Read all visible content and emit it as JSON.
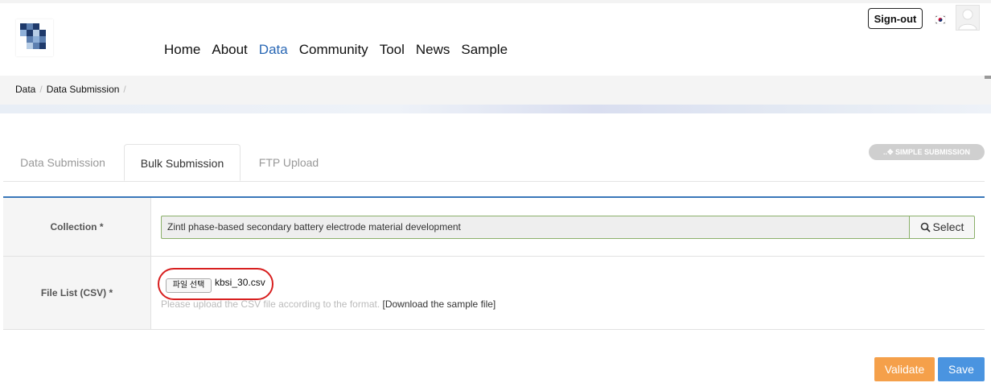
{
  "nav": {
    "items": [
      {
        "label": "Home"
      },
      {
        "label": "About"
      },
      {
        "label": "Data",
        "active": true
      },
      {
        "label": "Community"
      },
      {
        "label": "Tool"
      },
      {
        "label": "News"
      },
      {
        "label": "Sample"
      }
    ],
    "active_color": "#2a68b5"
  },
  "account": {
    "signout_label": "Sign-out",
    "language_icon": "korea-flag-icon",
    "avatar_icon": "user-avatar-icon"
  },
  "breadcrumb": {
    "items": [
      "Data",
      "Data Submission"
    ]
  },
  "tabs": {
    "items": [
      {
        "label": "Data Submission"
      },
      {
        "label": "Bulk Submission",
        "active": true
      },
      {
        "label": "FTP Upload"
      }
    ]
  },
  "simple_submission": {
    "label": "SIMPLE SUBMISSION",
    "icon": "move-icon"
  },
  "form": {
    "collection_label": "Collection *",
    "collection_value": "Zintl phase-based secondary battery electrode material development",
    "select_label": "Select",
    "select_icon": "search-icon",
    "file_label": "File List (CSV) *",
    "file_button_label": "파일 선택",
    "file_name": "kbsi_30.csv",
    "hint_text": "Please upload the CSV file according to the format.",
    "sample_link": "[Download the sample file]"
  },
  "actions": {
    "validate_label": "Validate",
    "save_label": "Save"
  },
  "colors": {
    "accent_blue": "#3a77b9",
    "validate": "#f5a04a",
    "save": "#4a94e0",
    "highlight_circle": "#d81f1f"
  }
}
